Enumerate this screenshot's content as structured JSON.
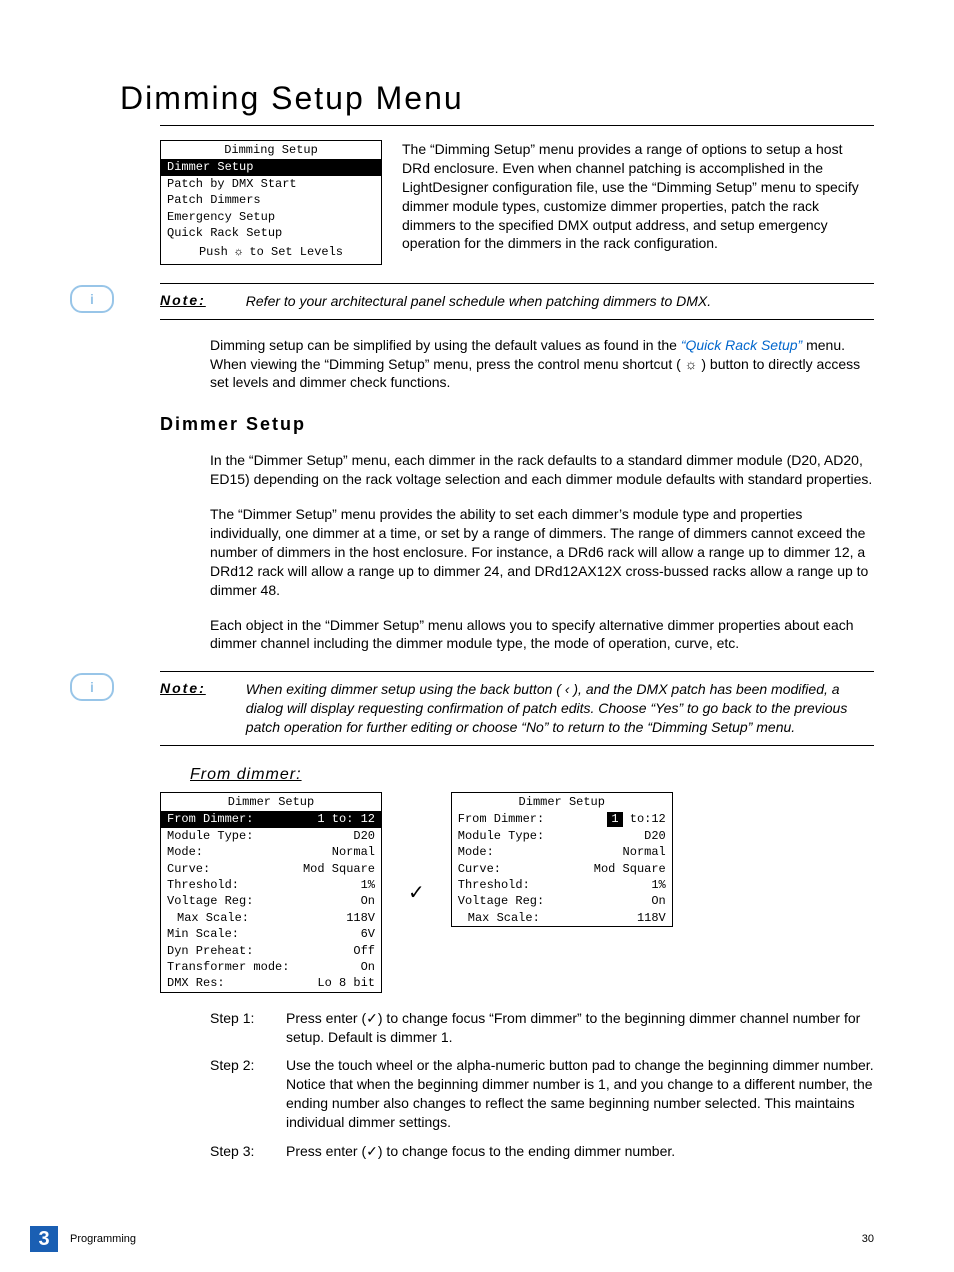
{
  "title": "Dimming Setup Menu",
  "lcd_menu": {
    "title": "Dimming Setup",
    "items": [
      {
        "label": "Dimmer Setup",
        "selected": true
      },
      {
        "label": "Patch by DMX Start",
        "selected": false
      },
      {
        "label": "Patch Dimmers",
        "selected": false
      },
      {
        "label": "Emergency Setup",
        "selected": false
      },
      {
        "label": "Quick Rack Setup",
        "selected": false
      }
    ],
    "footer_prefix": "Push ",
    "footer_suffix": " to Set Levels"
  },
  "intro_paragraph": "The “Dimming Setup” menu provides a range of options to setup a host DRd enclosure. Even when channel patching is accomplished in the LightDesigner configuration file, use the “Dimming Setup” menu to specify dimmer module types, customize dimmer properties, patch the rack dimmers to the specified DMX output address, and setup emergency operation for the dimmers in the rack configuration.",
  "note1": {
    "label": "Note:",
    "text": "Refer to your architectural panel schedule when patching dimmers to DMX."
  },
  "body2_prefix": "Dimming setup can be simplified by using the default values as found in the ",
  "body2_link": "“Quick Rack Setup”",
  "body2_suffix": "  menu. When viewing the “Dimming Setup” menu, press the control menu shortcut ( ☼ ) button to directly access set levels and dimmer check functions.",
  "subsection": "Dimmer Setup",
  "para3": "In the “Dimmer Setup” menu, each dimmer in the rack defaults to a standard dimmer module (D20, AD20, ED15) depending on the rack voltage selection and each dimmer module defaults with standard properties.",
  "para4": "The “Dimmer Setup” menu provides the ability to set each dimmer’s module type and properties individually, one dimmer at a time, or set by a range of dimmers. The range of dimmers cannot exceed the number of dimmers in the host enclosure. For instance, a DRd6 rack will allow a range up to dimmer 12, a DRd12 rack will allow a range up to dimmer 24, and DRd12AX12X cross-bussed racks allow a range up to dimmer 48.",
  "para5": "Each object in the “Dimmer Setup” menu allows you to specify alternative dimmer properties about each dimmer channel including the dimmer module type, the mode of operation, curve, etc.",
  "note2": {
    "label": "Note:",
    "text": "When exiting dimmer setup using the back button ( ‹ ), and the DMX patch has been modified, a dialog will display requesting confirmation of patch edits. Choose “Yes” to go back to the previous patch operation for further editing or choose “No” to return to the “Dimming Setup” menu."
  },
  "subsubsection": "From dimmer:",
  "screen_left": {
    "title": "Dimmer Setup",
    "rows": [
      {
        "label": "From Dimmer:",
        "value": "1 to: 12",
        "selected": true
      },
      {
        "label": "Module Type:",
        "value": "D20"
      },
      {
        "label": "Mode:",
        "value": "Normal"
      },
      {
        "label": "Curve:",
        "value": "Mod Square"
      },
      {
        "label": "Threshold:",
        "value": "1%"
      },
      {
        "label": "Voltage Reg:",
        "value": "On"
      },
      {
        "label": "Max Scale:",
        "value": "118V",
        "indent": true
      },
      {
        "label": "Min Scale:",
        "value": "6V"
      },
      {
        "label": "Dyn Preheat:",
        "value": "Off"
      },
      {
        "label": "Transformer mode:",
        "value": "On"
      },
      {
        "label": "DMX Res:",
        "value": "Lo 8 bit"
      }
    ]
  },
  "screen_right": {
    "title": "Dimmer Setup",
    "rows": [
      {
        "label": "From Dimmer:",
        "value_prefix": "",
        "value_box": "1",
        "value_suffix": " to:12"
      },
      {
        "label": "Module Type:",
        "value": "D20"
      },
      {
        "label": "Mode:",
        "value": "Normal"
      },
      {
        "label": "Curve:",
        "value": "Mod Square"
      },
      {
        "label": "Threshold:",
        "value": "1%"
      },
      {
        "label": "Voltage Reg:",
        "value": "On"
      },
      {
        "label": "Max Scale:",
        "value": "118V",
        "indent": true
      }
    ]
  },
  "steps": [
    {
      "label": "Step 1:",
      "text_prefix": "Press enter (",
      "glyph": "✓",
      "text_suffix": ") to change focus “From dimmer” to the beginning dimmer channel number for setup. Default is dimmer 1."
    },
    {
      "label": "Step 2:",
      "text_prefix": "Use the touch wheel or the alpha-numeric button pad to change the beginning dimmer number. Notice that when the beginning dimmer number is 1, and you change to a different number, the ending number also changes to reflect the same beginning number selected. This maintains individual dimmer settings.",
      "glyph": "",
      "text_suffix": ""
    },
    {
      "label": "Step 3:",
      "text_prefix": "Press enter (",
      "glyph": "✓",
      "text_suffix": ") to change focus to the ending dimmer number."
    }
  ],
  "footer": {
    "chapter_num": "3",
    "chapter_label": "Programming",
    "page_num": "30"
  }
}
